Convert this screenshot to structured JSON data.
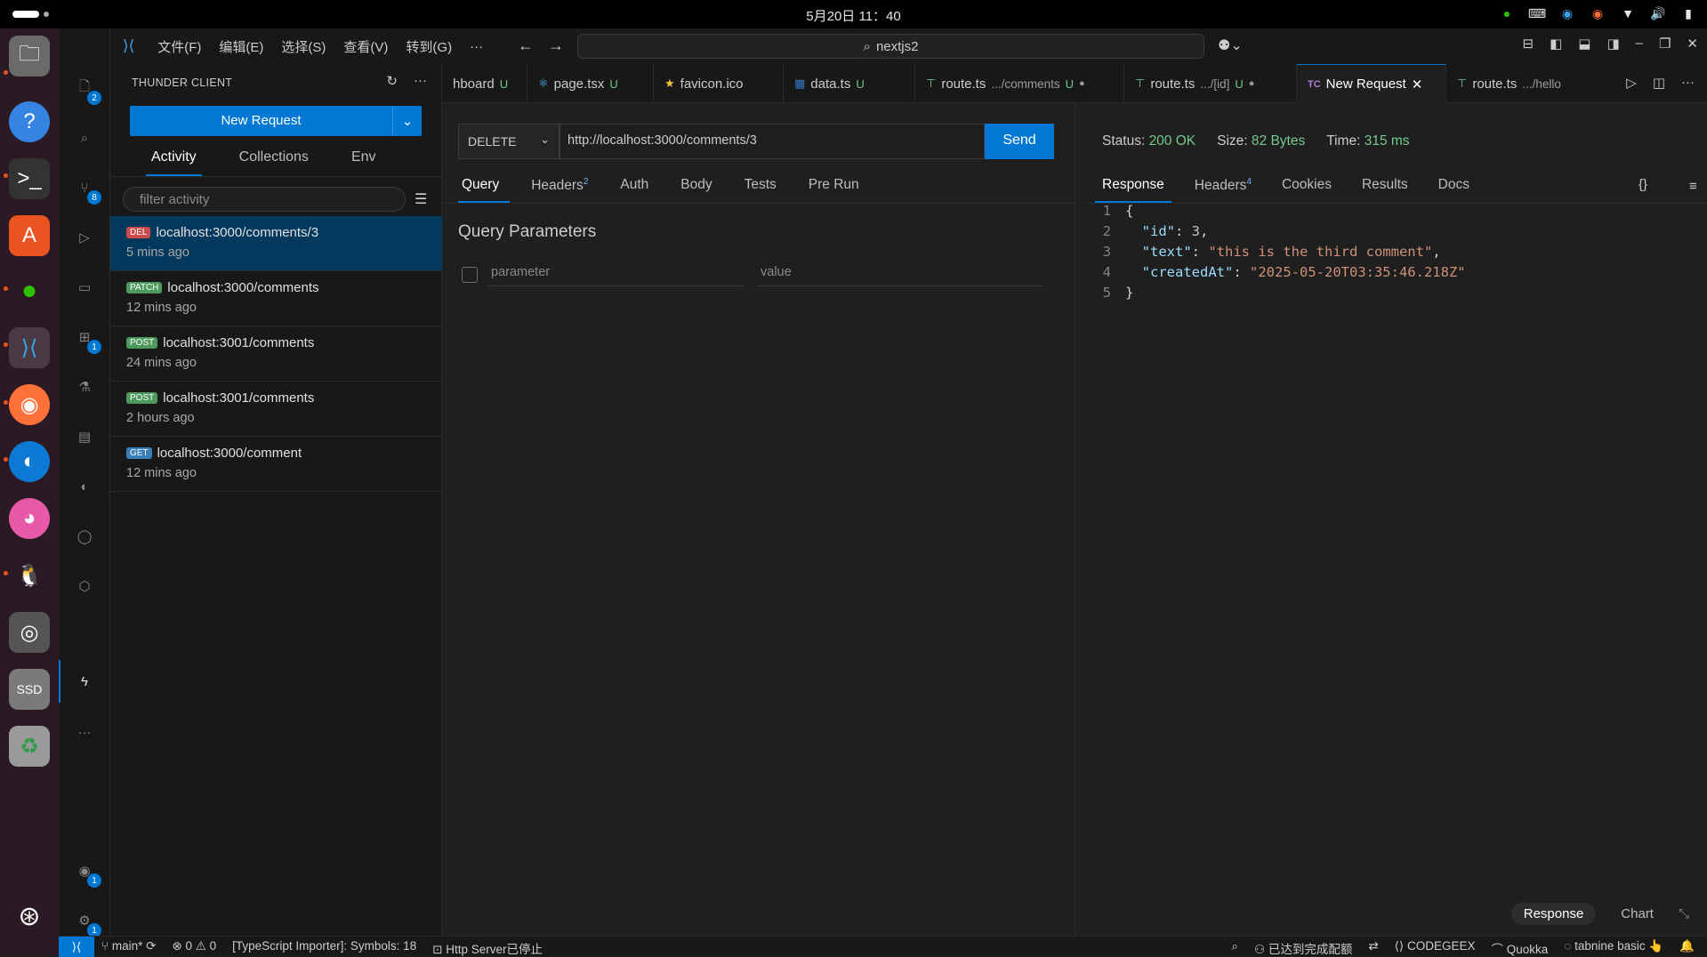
{
  "system": {
    "clock": "5月20日  11：40",
    "tray_icons": [
      "wechat-icon",
      "keyboard-icon",
      "app-icon",
      "notify-icon",
      "wifi-icon",
      "volume-icon",
      "battery-icon"
    ]
  },
  "dock": {
    "apps": [
      "files",
      "help",
      "terminal",
      "app-center",
      "wechat",
      "vscode",
      "firefox",
      "edge",
      "cat-app",
      "penguin-app",
      "disks",
      "ssd",
      "trash"
    ],
    "ssd_label": "SSD"
  },
  "activity_bar": {
    "explorer_badge": "2",
    "scm_badge": "8",
    "extensions_badge": "1",
    "accounts_badge": "1",
    "settings_badge": "1"
  },
  "menu": {
    "items": [
      "文件(F)",
      "编辑(E)",
      "选择(S)",
      "查看(V)",
      "转到(G)",
      "···"
    ],
    "search": "nextjs2"
  },
  "sidebar": {
    "title": "THUNDER CLIENT",
    "new_request": "New Request",
    "tabs": [
      "Activity",
      "Collections",
      "Env"
    ],
    "filter_placeholder": "filter activity",
    "items": [
      {
        "method": "DEL",
        "color": "#c94b4b",
        "url": "localhost:3000/comments/3",
        "ago": "5 mins ago"
      },
      {
        "method": "PATCH",
        "color": "#4e9a5e",
        "url": "localhost:3000/comments",
        "ago": "12 mins ago"
      },
      {
        "method": "POST",
        "color": "#4e9a5e",
        "url": "localhost:3001/comments",
        "ago": "24 mins ago"
      },
      {
        "method": "POST",
        "color": "#4e9a5e",
        "url": "localhost:3001/comments",
        "ago": "2 hours ago"
      },
      {
        "method": "GET",
        "color": "#3b7fb8",
        "url": "localhost:3000/comment",
        "ago": "12 mins ago"
      }
    ]
  },
  "editor_tabs": [
    {
      "label": "hboard",
      "dim": "",
      "mod": "U",
      "icon": ""
    },
    {
      "label": "page.tsx",
      "dim": "",
      "mod": "U",
      "icon": "⚛"
    },
    {
      "label": "favicon.ico",
      "dim": "",
      "mod": "",
      "icon": "★"
    },
    {
      "label": "data.ts",
      "dim": "",
      "mod": "U",
      "icon": "▦"
    },
    {
      "label": "route.ts",
      "dim": ".../comments",
      "mod": "U",
      "icon": "⊤",
      "dot": "●"
    },
    {
      "label": "route.ts",
      "dim": ".../[id]",
      "mod": "U",
      "icon": "⊤",
      "dot": "●"
    },
    {
      "label": "New Request",
      "dim": "",
      "mod": "",
      "icon": "TC",
      "close": "✕"
    },
    {
      "label": "route.ts",
      "dim": ".../hello",
      "mod": "",
      "icon": "⊤"
    }
  ],
  "request": {
    "method": "DELETE",
    "url": "http://localhost:3000/comments/3",
    "send": "Send",
    "tabs": [
      {
        "label": "Query",
        "sup": ""
      },
      {
        "label": "Headers",
        "sup": "2"
      },
      {
        "label": "Auth",
        "sup": ""
      },
      {
        "label": "Body",
        "sup": ""
      },
      {
        "label": "Tests",
        "sup": ""
      },
      {
        "label": "Pre Run",
        "sup": ""
      }
    ],
    "section_title": "Query Parameters",
    "param_placeholder": "parameter",
    "value_placeholder": "value"
  },
  "response": {
    "status_label": "Status:",
    "status": "200 OK",
    "size_label": "Size:",
    "size": "82 Bytes",
    "time_label": "Time:",
    "time": "315 ms",
    "tabs": [
      {
        "label": "Response",
        "sup": ""
      },
      {
        "label": "Headers",
        "sup": "4"
      },
      {
        "label": "Cookies",
        "sup": ""
      },
      {
        "label": "Results",
        "sup": ""
      },
      {
        "label": "Docs",
        "sup": ""
      }
    ],
    "braces": "{}",
    "lines": [
      {
        "n": "1",
        "t": "{"
      },
      {
        "n": "2",
        "k": "\"id\"",
        "v": "3",
        "type": "num",
        "tail": ","
      },
      {
        "n": "3",
        "k": "\"text\"",
        "v": "\"this is the third comment\"",
        "type": "str",
        "tail": ","
      },
      {
        "n": "4",
        "k": "\"createdAt\"",
        "v": "\"2025-05-20T03:35:46.218Z\"",
        "type": "str",
        "tail": ""
      },
      {
        "n": "5",
        "t": "}"
      }
    ],
    "bottom_tabs": [
      "Response",
      "Chart"
    ]
  },
  "statusbar": {
    "branch": "main*",
    "problems": "⊗ 0 ⚠ 0",
    "ts_importer": "[TypeScript Importer]: Symbols: 18",
    "http_server": "Http Server已停止",
    "right": [
      "已达到完成配额",
      "CODEGEEX",
      "Quokka",
      "tabnine basic 👆"
    ]
  }
}
